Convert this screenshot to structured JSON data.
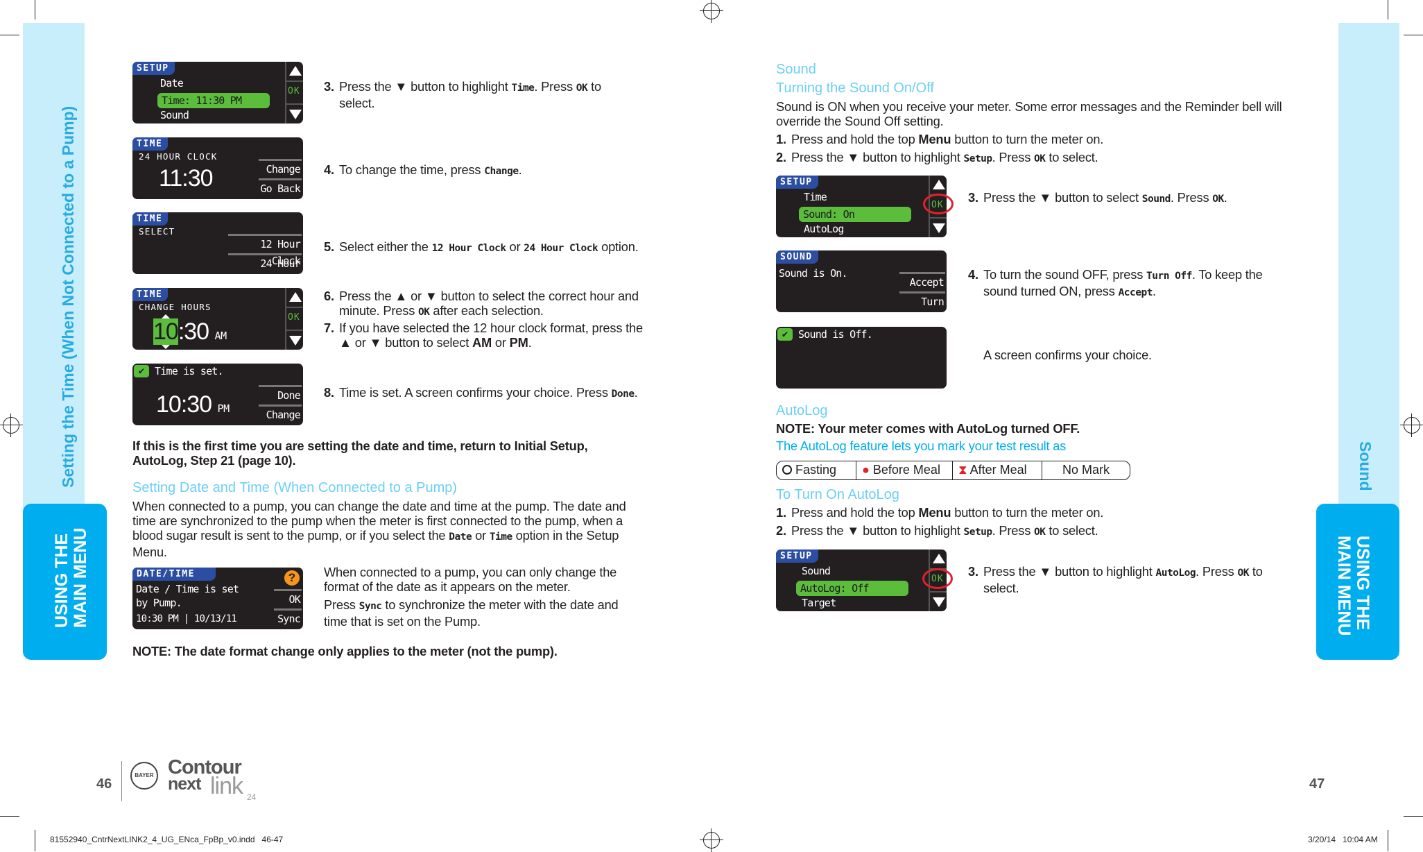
{
  "colors": {
    "accent": "#00aeef",
    "band": "#c9eefb",
    "heading": "#6ccff6",
    "lcd_bg": "#231f20",
    "lcd_tab": "#2b4ea3",
    "lcd_highlight": "#5cbd3c",
    "help": "#f7941d",
    "ring": "#e4202a"
  },
  "left_band": {
    "title": "Setting the Time (When Not Connected to a Pump)",
    "tab": "USING THE MAIN MENU",
    "tab_line1": "USING THE",
    "tab_line2": "MAIN MENU"
  },
  "right_band": {
    "title": "Sound",
    "tab_line1": "USING THE",
    "tab_line2": "MAIN MENU"
  },
  "left": {
    "screens": {
      "setup": {
        "tab": "SETUP",
        "line1": "Date",
        "highlight": "Time: 11:30 PM",
        "line3": "Sound",
        "ok": "OK"
      },
      "clock": {
        "tab": "TIME",
        "sub": "24 HOUR CLOCK",
        "time": "11:30",
        "btn1": "Change",
        "btn2": "Go Back"
      },
      "select": {
        "tab": "TIME",
        "sub": "SELECT",
        "btn1": "12 Hour Clock",
        "btn2": "24 Hour Clock"
      },
      "hours": {
        "tab": "TIME",
        "sub": "CHANGE HOURS",
        "hour": "10",
        "rest": ":30",
        "ampm": "AM",
        "ok": "OK"
      },
      "set": {
        "msg": "Time is set.",
        "time": "10:30",
        "ampm": "PM",
        "btn1": "Done",
        "btn2": "Change"
      },
      "datetime": {
        "tab": "DATE/TIME",
        "line1": "Date / Time is set",
        "line2": "by Pump.",
        "line3": "10:30 PM | 10/13/11",
        "btn1": "OK",
        "btn2": "Sync",
        "help": "?"
      }
    },
    "steps": [
      {
        "n": "3.",
        "parts": [
          {
            "t": "Press the ▼ button to highlight "
          },
          {
            "t": "Time",
            "f": "m"
          },
          {
            "t": ". Press "
          },
          {
            "t": "OK",
            "f": "m"
          },
          {
            "t": " to select."
          }
        ]
      },
      {
        "n": "4.",
        "parts": [
          {
            "t": "To change the time, press "
          },
          {
            "t": "Change",
            "f": "m"
          },
          {
            "t": "."
          }
        ]
      },
      {
        "n": "5.",
        "parts": [
          {
            "t": "Select either the "
          },
          {
            "t": "12 Hour Clock",
            "f": "m"
          },
          {
            "t": " or "
          },
          {
            "t": "24 Hour Clock",
            "f": "m"
          },
          {
            "t": " option."
          }
        ]
      },
      {
        "n": "6.",
        "parts": [
          {
            "t": "Press the ▲ or ▼ button to select the correct hour and minute. Press "
          },
          {
            "t": "OK",
            "f": "m"
          },
          {
            "t": " after each selection."
          }
        ]
      },
      {
        "n": "7.",
        "parts": [
          {
            "t": "If you have selected the 12 hour clock format, press the ▲ or ▼ button to select "
          },
          {
            "t": "AM",
            "f": "b"
          },
          {
            "t": " or "
          },
          {
            "t": "PM",
            "f": "b"
          },
          {
            "t": "."
          }
        ]
      },
      {
        "n": "8.",
        "parts": [
          {
            "t": "Time is set. A screen confirms your choice. Press "
          },
          {
            "t": "Done",
            "f": "m"
          },
          {
            "t": "."
          }
        ]
      }
    ],
    "first_time_note": "If this is the first time you are setting the date and time, return to Initial Setup, AutoLog, Step 21 (page 10).",
    "pump_heading": "Setting Date and Time (When Connected to a Pump)",
    "pump_para": [
      {
        "t": "When connected to a pump, you can change the date and time at the pump. The date and time are synchronized to the pump when the meter is first connected to the pump, when a blood sugar result is sent to the pump, or if you select the "
      },
      {
        "t": "Date",
        "f": "m"
      },
      {
        "t": " or "
      },
      {
        "t": "Time",
        "f": "m"
      },
      {
        "t": " option in the Setup Menu."
      }
    ],
    "pump_side1": "When connected to a pump, you can only change the format of the date as it appears on the meter.",
    "pump_side2": [
      {
        "t": "Press "
      },
      {
        "t": "Sync",
        "f": "m"
      },
      {
        "t": " to synchronize the meter with the date and time that is set on the Pump."
      }
    ],
    "note": "NOTE: The date format change only applies to the meter (not the pump).",
    "page_number": "46",
    "logo": {
      "bayer": "BAYER",
      "contour": "Contour",
      "next": "next",
      "link": "link",
      "model": "24"
    }
  },
  "right": {
    "heading": "Sound",
    "subheading": "Turning the Sound On/Off",
    "intro": "Sound is ON when you receive your meter. Some error messages and the Reminder bell will override the Sound Off setting.",
    "steps_top": [
      {
        "n": "1.",
        "parts": [
          {
            "t": "Press and hold the top "
          },
          {
            "t": "Menu",
            "f": "b"
          },
          {
            "t": " button to turn the meter on."
          }
        ]
      },
      {
        "n": "2.",
        "parts": [
          {
            "t": "Press the ▼ button to highlight "
          },
          {
            "t": "Setup",
            "f": "m"
          },
          {
            "t": ". Press "
          },
          {
            "t": "OK",
            "f": "m"
          },
          {
            "t": " to select."
          }
        ]
      }
    ],
    "screens": {
      "setup1": {
        "tab": "SETUP",
        "line1": "Time",
        "highlight": "Sound: On",
        "line3": "AutoLog",
        "ok": "OK"
      },
      "sound": {
        "tab": "SOUND",
        "msg": "Sound is On.",
        "btn1": "Accept",
        "btn2": "Turn Off"
      },
      "off": {
        "msg": "Sound is Off."
      },
      "setup2": {
        "tab": "SETUP",
        "line1": "Sound",
        "highlight": "AutoLog: Off",
        "line3": "Target",
        "ok": "OK"
      }
    },
    "steps_screens": [
      {
        "n": "3.",
        "parts": [
          {
            "t": "Press the ▼ button to select "
          },
          {
            "t": "Sound",
            "f": "m"
          },
          {
            "t": ". Press "
          },
          {
            "t": "OK",
            "f": "m"
          },
          {
            "t": "."
          }
        ]
      },
      {
        "n": "4.",
        "parts": [
          {
            "t": "To turn the sound OFF, press "
          },
          {
            "t": "Turn Off",
            "f": "m"
          },
          {
            "t": ". To keep the sound turned ON, press "
          },
          {
            "t": "Accept",
            "f": "m"
          },
          {
            "t": "."
          }
        ]
      }
    ],
    "confirm": "A screen confirms your choice.",
    "autolog_heading": "AutoLog",
    "autolog_note": "NOTE: Your meter comes with AutoLog turned OFF.",
    "autolog_feature": "The AutoLog feature lets you mark your test result as",
    "marks": [
      "Fasting",
      "Before Meal",
      "After Meal",
      "No Mark"
    ],
    "turn_on_heading": "To Turn On AutoLog",
    "steps_autolog": [
      {
        "n": "1.",
        "parts": [
          {
            "t": "Press and hold the top "
          },
          {
            "t": "Menu",
            "f": "b"
          },
          {
            "t": " button to turn the meter on."
          }
        ]
      },
      {
        "n": "2.",
        "parts": [
          {
            "t": "Press the ▼ button to highlight "
          },
          {
            "t": "Setup",
            "f": "m"
          },
          {
            "t": ". Press "
          },
          {
            "t": "OK",
            "f": "m"
          },
          {
            "t": " to select."
          }
        ]
      },
      {
        "n": "3.",
        "parts": [
          {
            "t": "Press the ▼ button to highlight "
          },
          {
            "t": "AutoLog",
            "f": "m"
          },
          {
            "t": ". Press "
          },
          {
            "t": "OK",
            "f": "m"
          },
          {
            "t": " to select."
          }
        ]
      }
    ],
    "page_number": "47"
  },
  "footer": {
    "file": "81552940_CntrNextLINK2_4_UG_ENca_FpBp_v0.indd   46-47",
    "date": "3/20/14   10:04 AM"
  }
}
